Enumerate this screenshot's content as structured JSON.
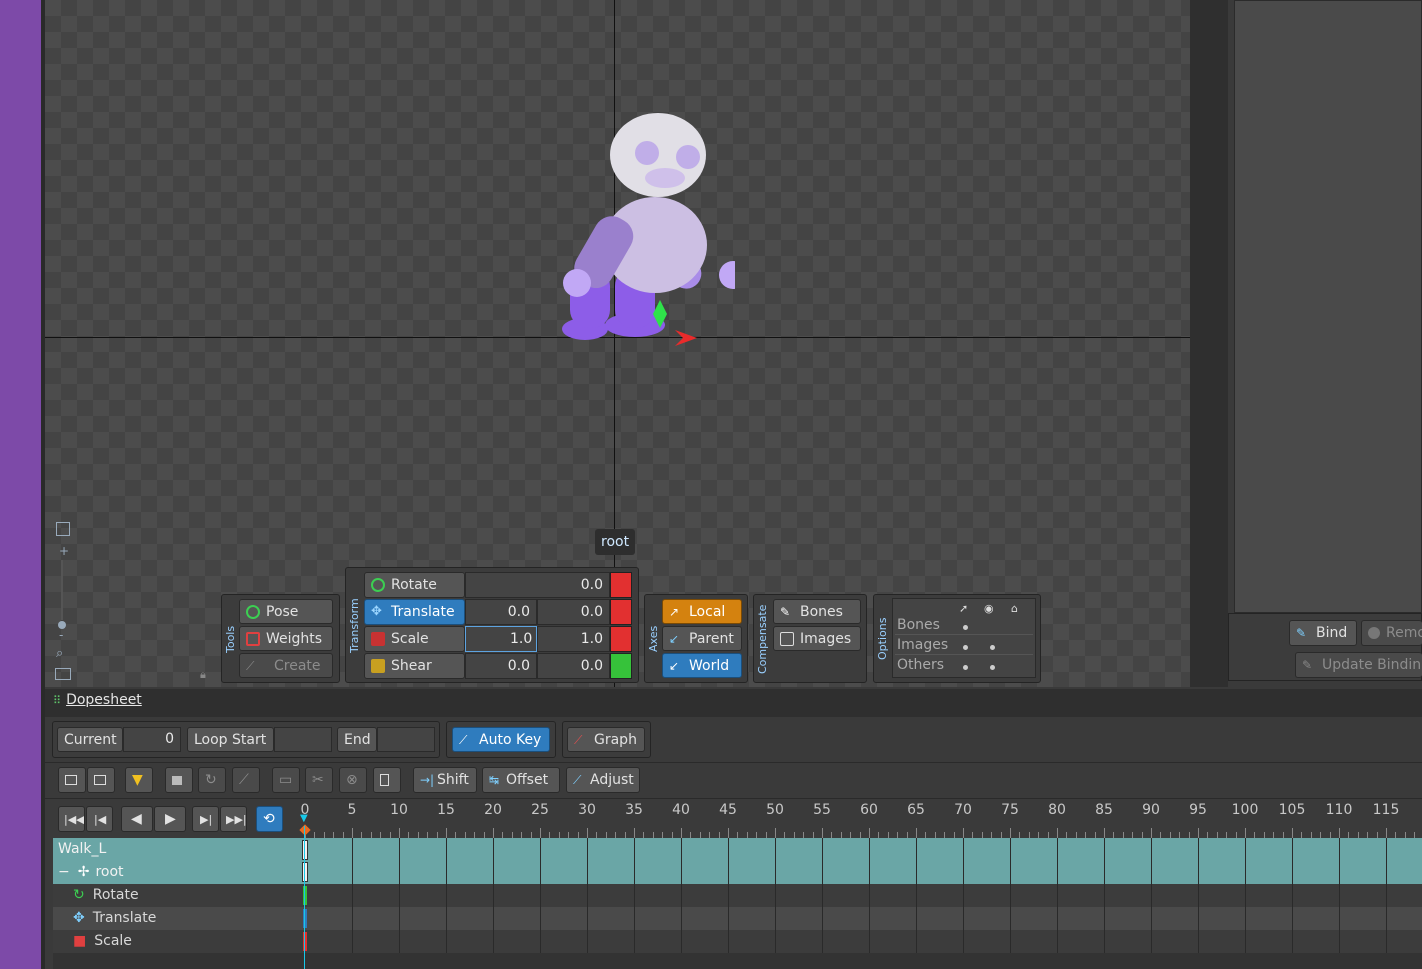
{
  "viewport": {
    "bone_tooltip": "root"
  },
  "tools": {
    "section_label": "Tools",
    "pose": "Pose",
    "weights": "Weights",
    "create": "Create"
  },
  "transform": {
    "section_label": "Transform",
    "rotate": {
      "label": "Rotate",
      "value": "0.0"
    },
    "translate": {
      "label": "Translate",
      "x": "0.0",
      "y": "0.0"
    },
    "scale": {
      "label": "Scale",
      "x": "1.0",
      "y": "1.0"
    },
    "shear": {
      "label": "Shear",
      "x": "0.0",
      "y": "0.0"
    }
  },
  "axes": {
    "section_label": "Axes",
    "local": "Local",
    "parent": "Parent",
    "world": "World"
  },
  "compensate": {
    "section_label": "Compensate",
    "bones": "Bones",
    "images": "Images"
  },
  "options": {
    "section_label": "Options",
    "rows": [
      "Bones",
      "Images",
      "Others"
    ]
  },
  "right_panel": {
    "bind": "Bind",
    "remove": "Remo",
    "update_binding": "Update Bindin"
  },
  "dopesheet": {
    "tab": "Dopesheet",
    "current_label": "Current",
    "current_value": "0",
    "loop_start_label": "Loop Start",
    "loop_start_value": "",
    "end_label": "End",
    "end_value": "",
    "auto_key": "Auto Key",
    "graph": "Graph",
    "shift": "Shift",
    "offset": "Offset",
    "adjust": "Adjust",
    "ruler": [
      "0",
      "5",
      "10",
      "15",
      "20",
      "25",
      "30",
      "35",
      "40",
      "45",
      "50",
      "55",
      "60",
      "65",
      "70",
      "75",
      "80",
      "85",
      "90",
      "95",
      "100",
      "105",
      "110",
      "115"
    ],
    "tracks": {
      "animation": "Walk_L",
      "bone": "root",
      "collapse": "−",
      "rotate": "Rotate",
      "translate": "Translate",
      "scale": "Scale"
    }
  },
  "colors": {
    "accent_blue": "#2f7cbe",
    "accent_orange": "#d4820f",
    "key_red": "#e23030",
    "key_green": "#36c23a",
    "teal_row": "#6aa6a6",
    "sidebar_purple": "#7d4aa8"
  }
}
